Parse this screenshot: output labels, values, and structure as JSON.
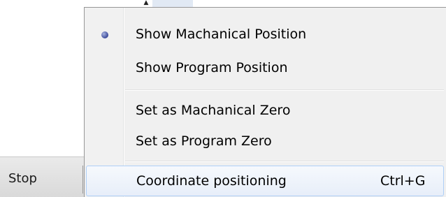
{
  "background": {
    "stop_label": "Stop"
  },
  "menu": {
    "items": [
      {
        "label": "Show Machanical Position",
        "checked": true,
        "shortcut": ""
      },
      {
        "label": "Show Program Position",
        "checked": false,
        "shortcut": ""
      },
      {
        "label": "Set as Machanical Zero",
        "checked": false,
        "shortcut": ""
      },
      {
        "label": "Set as Program Zero",
        "checked": false,
        "shortcut": ""
      },
      {
        "label": "Coordinate positioning",
        "checked": false,
        "shortcut": "Ctrl+G",
        "highlighted": true
      }
    ]
  },
  "colors": {
    "menu_background": "#f0f0f0",
    "highlight_border": "#aecff7",
    "bullet": "#3c4a9a"
  }
}
